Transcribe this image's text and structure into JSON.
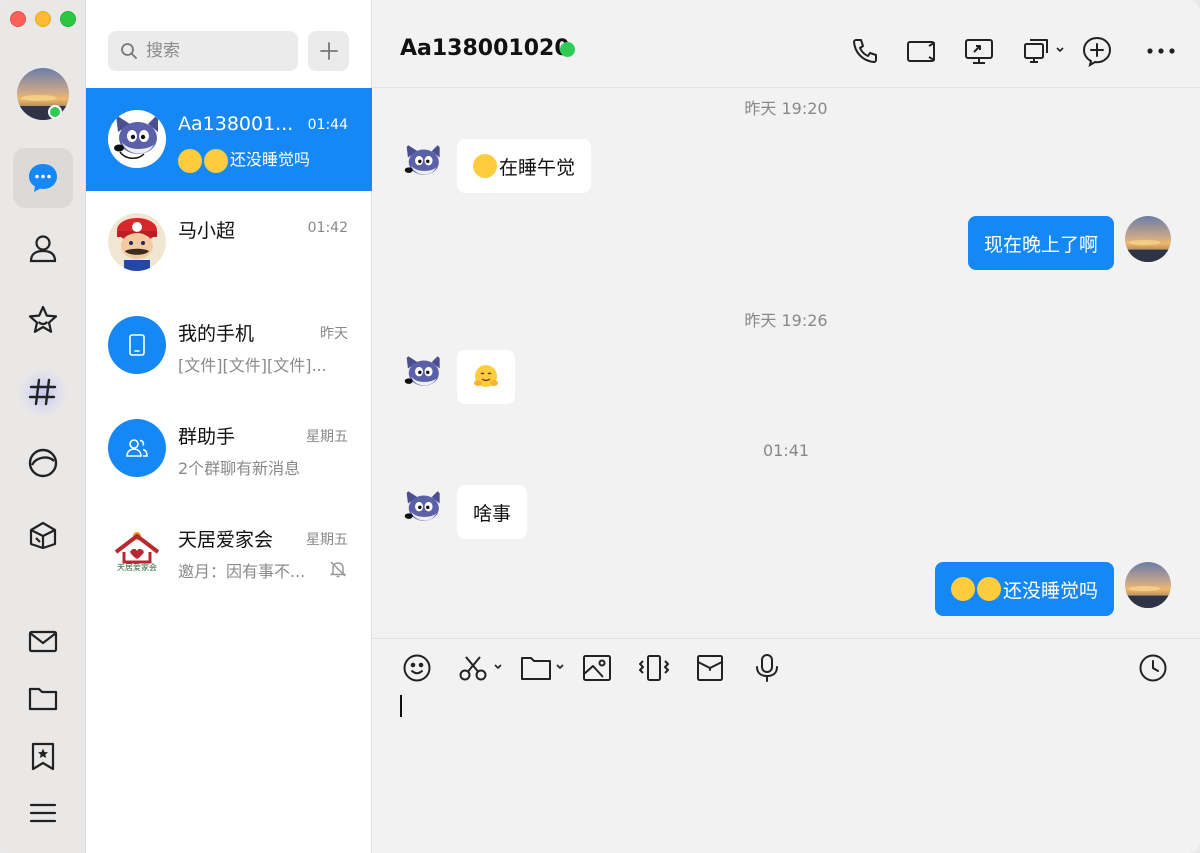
{
  "user": {
    "status": "online"
  },
  "search": {
    "placeholder": "搜索"
  },
  "conversations": [
    {
      "name": "Aa138001...",
      "time": "01:44",
      "preview": "还没睡觉吗",
      "active": true
    },
    {
      "name": "马小超",
      "time": "01:42",
      "preview": ""
    },
    {
      "name": "我的手机",
      "time": "昨天",
      "preview": "[文件][文件][文件]..."
    },
    {
      "name": "群助手",
      "time": "星期五",
      "preview": "2个群聊有新消息"
    },
    {
      "name": "天居爱家会",
      "time": "星期五",
      "preview": "邀月：因有事不...",
      "muted": true,
      "logo_text": "天居爱家会"
    }
  ],
  "chat": {
    "title": "Aa138001020",
    "messages": [
      {
        "type": "timestamp",
        "text": "昨天 19:20"
      },
      {
        "type": "in",
        "text": "在睡午觉"
      },
      {
        "type": "out",
        "text": "现在晚上了啊"
      },
      {
        "type": "timestamp",
        "text": "昨天 19:26"
      },
      {
        "type": "in",
        "text": ""
      },
      {
        "type": "timestamp",
        "text": "01:41"
      },
      {
        "type": "in",
        "text": "啥事"
      },
      {
        "type": "out",
        "text": "还没睡觉吗"
      }
    ]
  },
  "header_icons": [
    "phone-icon",
    "video-call-icon",
    "screen-share-icon",
    "remote-desktop-icon",
    "add-member-icon",
    "more-icon"
  ],
  "toolbar_icons": [
    "emoji-icon",
    "scissors-icon",
    "folder-icon",
    "image-icon",
    "shake-icon",
    "red-packet-icon",
    "microphone-icon",
    "history-icon"
  ],
  "colors": {
    "accent": "#1688f6",
    "online": "#2fcb55",
    "incoming_bubble": "#ffffff",
    "outgoing_bubble": "#1688f6"
  }
}
